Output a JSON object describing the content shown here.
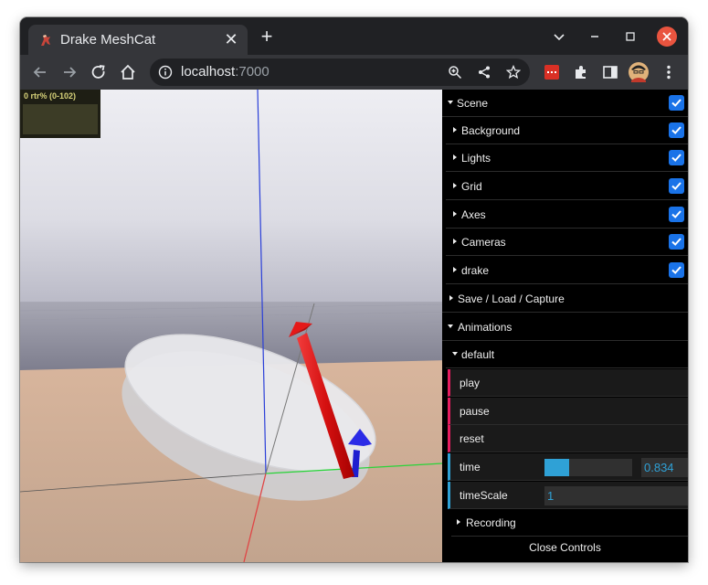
{
  "browser": {
    "tab_title": "Drake MeshCat",
    "url_host": "localhost",
    "url_port": ":7000",
    "icons": {
      "tab_close": "close-icon",
      "new_tab": "plus-icon",
      "back": "arrow-left-icon",
      "forward": "arrow-right-icon",
      "reload": "reload-icon",
      "home": "home-icon",
      "site_info": "info-icon",
      "zoom": "zoom-icon",
      "share": "share-icon",
      "bookmark": "star-icon",
      "extension_red": "extension-icon",
      "extensions": "puzzle-icon",
      "side_panel": "side-panel-icon",
      "profile": "avatar",
      "menu": "kebab-menu-icon"
    },
    "window_controls": {
      "minimize": "minimize-icon",
      "maximize": "maximize-icon",
      "close": "close-icon"
    }
  },
  "stats": {
    "label": "0 rtr% (0-102)"
  },
  "controls": {
    "scene": {
      "label": "Scene",
      "checked": true,
      "children": [
        {
          "label": "Background",
          "checked": true
        },
        {
          "label": "Lights",
          "checked": true
        },
        {
          "label": "Grid",
          "checked": true
        },
        {
          "label": "Axes",
          "checked": true
        },
        {
          "label": "Cameras",
          "checked": true
        },
        {
          "label": "drake",
          "checked": true
        }
      ]
    },
    "save_load_capture": "Save / Load / Capture",
    "animations": {
      "label": "Animations",
      "default": {
        "label": "default",
        "play": "play",
        "pause": "pause",
        "reset": "reset",
        "time": {
          "label": "time",
          "value": "0.834",
          "fill_fraction": 0.28
        },
        "timescale": {
          "label": "timeScale",
          "value": "1"
        },
        "recording": "Recording"
      }
    },
    "close_controls": "Close Controls"
  },
  "colors": {
    "accent_checkbox": "#1a73e8",
    "function_bar": "#e61d5f",
    "number_bar": "#2fa1d6",
    "close_button": "#e9543f"
  }
}
